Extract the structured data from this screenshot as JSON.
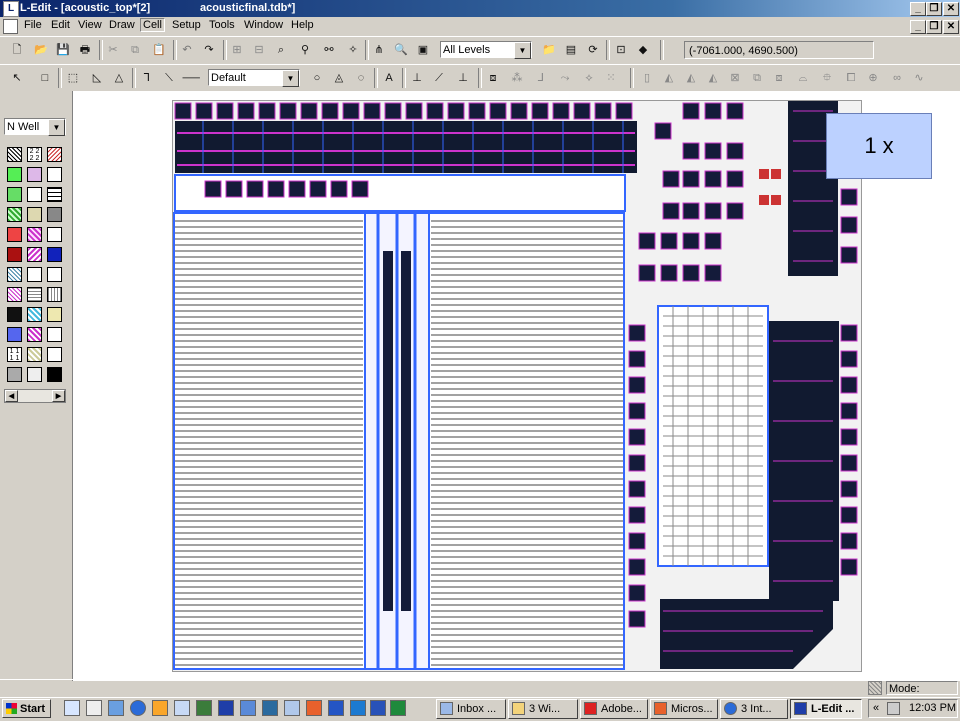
{
  "window": {
    "title": "L-Edit - [acoustic_top*[2]",
    "file_title": "acousticfinal.tdb*]",
    "minimize": "_",
    "restore": "❐",
    "close": "✕"
  },
  "menu": [
    "File",
    "Edit",
    "View",
    "Draw",
    "Cell",
    "Setup",
    "Tools",
    "Window",
    "Help"
  ],
  "toolbar1": {
    "levels": "All Levels",
    "coords": "(-7061.000, 4690.500)"
  },
  "toolbar2": {
    "style": "Default"
  },
  "palette": {
    "layer": "N Well"
  },
  "canvas": {
    "zoom_label": "1 x"
  },
  "status": {
    "mode": "Mode: Drawing"
  },
  "taskbar": {
    "start": "Start",
    "tasks": [
      "Inbox ...",
      "3 Wi...",
      "Adobe...",
      "Micros...",
      "3 Int...",
      "L-Edit ..."
    ],
    "clock": "12:03 PM",
    "tray_chevron": "«"
  },
  "colors": {
    "title_start": "#0a246a",
    "chip_blue": "#3344ff",
    "pad": "#141b3a",
    "magenta": "#cc33cc"
  }
}
